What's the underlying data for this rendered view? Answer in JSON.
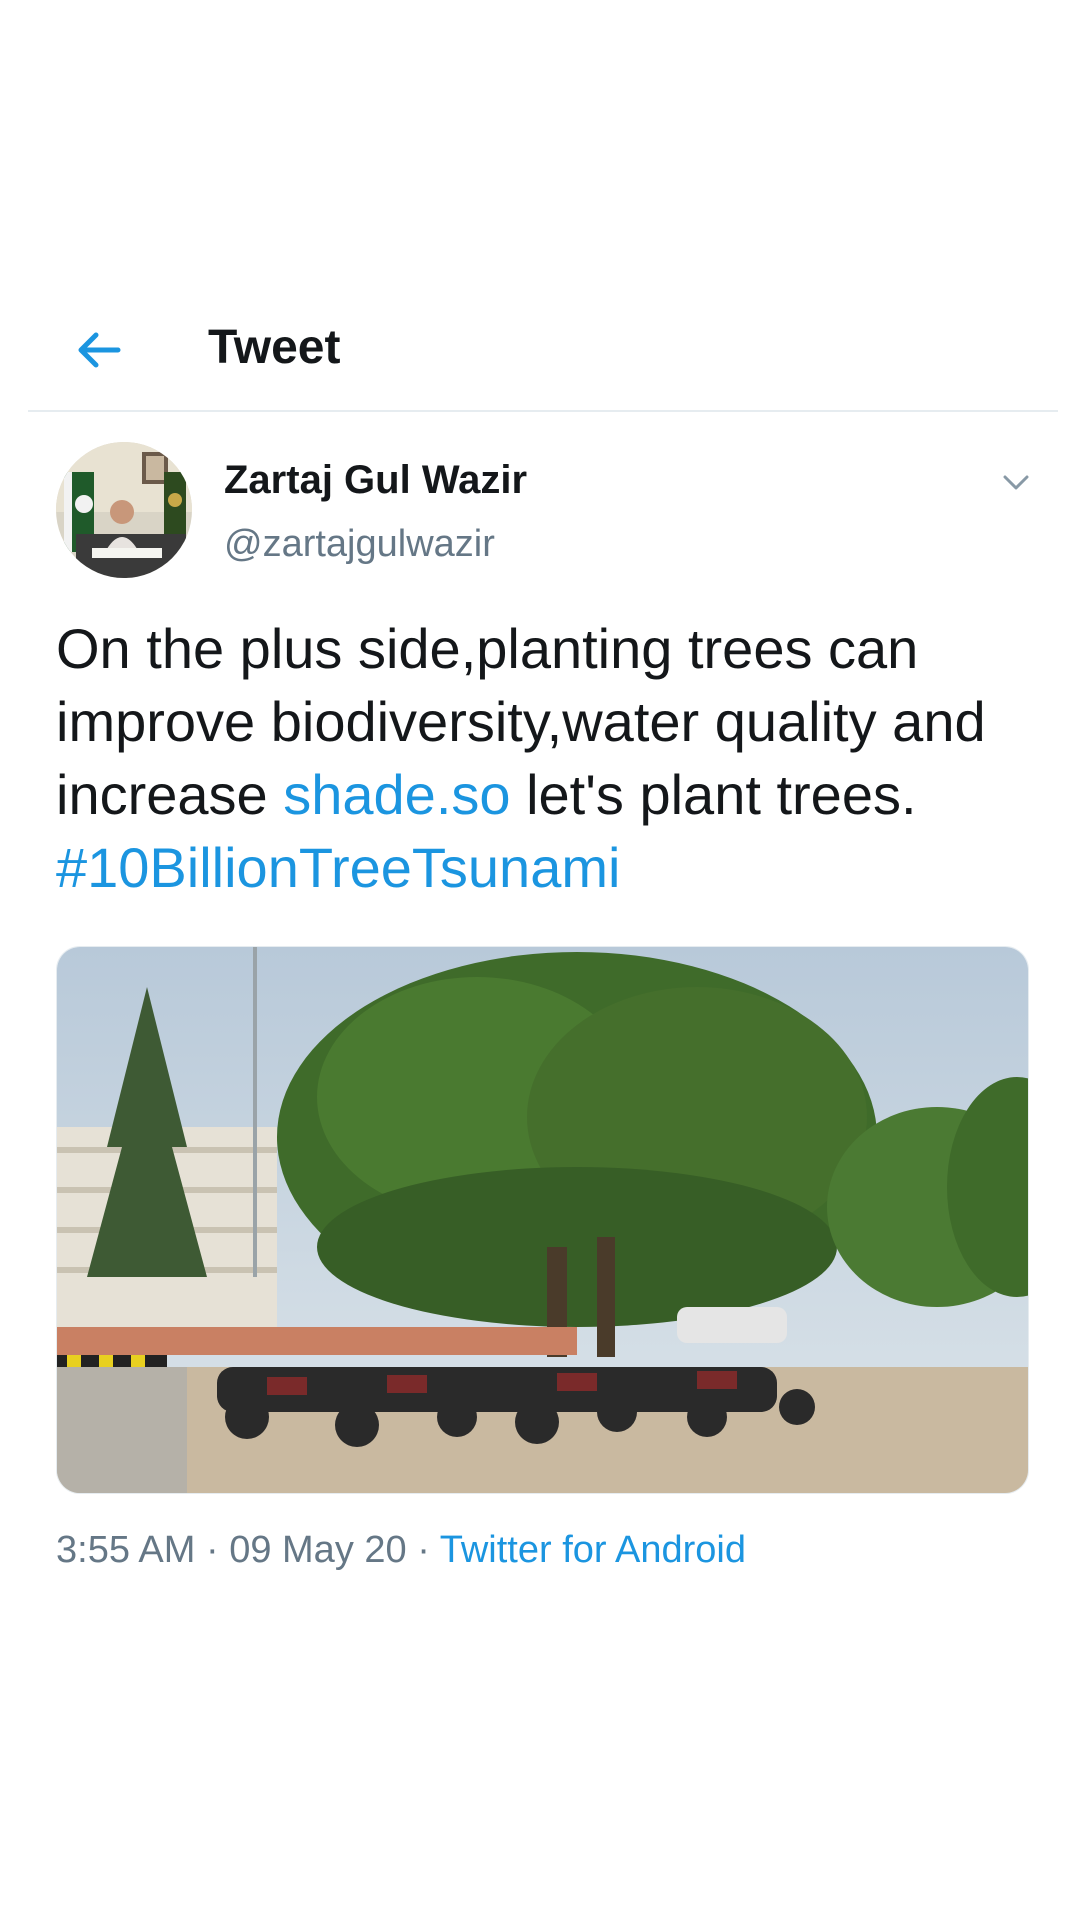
{
  "header": {
    "title": "Tweet",
    "back_icon": "back-arrow-icon"
  },
  "author": {
    "name": "Zartaj Gul Wazir",
    "handle": "@zartajgulwazir"
  },
  "tweet": {
    "text_part1": "On the plus side,planting trees can improve biodiversity,water quality and increase ",
    "link_text": "shade.so",
    "text_part2": " let's plant trees.",
    "hashtag": "#10BillionTreeTsunami"
  },
  "meta": {
    "time": "3:55 AM",
    "separator": " · ",
    "date": "09 May 20",
    "source": "Twitter for Android"
  },
  "colors": {
    "accent": "#1b95e0",
    "muted": "#657786",
    "text": "#14171a",
    "border": "#e6ecf0"
  }
}
